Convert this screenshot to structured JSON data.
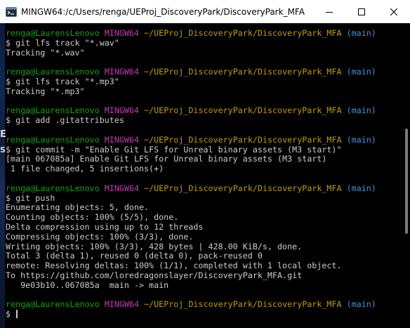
{
  "window": {
    "title": "MINGW64:/c/Users/renga/UEProj_DiscoveryPark/DiscoveryPark_MFA",
    "icon": "mingw-terminal-icon",
    "controls": [
      "minimize-icon",
      "maximize-icon",
      "close-icon"
    ]
  },
  "colors": {
    "user": "#13a10e",
    "system": "#c239b3",
    "path": "#c19c00",
    "branch": "#3a96dd",
    "output": "#cccccc",
    "background": "#000000"
  },
  "prompt": {
    "user": "renga@LaurensLenovo",
    "system": "MINGW64",
    "path": "~/UEProj_DiscoveryPark/DiscoveryPark_MFA",
    "branch": "(main)",
    "symbol": "$"
  },
  "terminal": {
    "blocks": [
      {
        "command": "git lfs track \"*.wav\"",
        "output": [
          "Tracking \"*.wav\""
        ]
      },
      {
        "command": "git lfs track \"*.mp3\"",
        "output": [
          "Tracking \"*.mp3\""
        ]
      },
      {
        "command": "git add .gitattributes",
        "output": []
      },
      {
        "command": "git commit -m \"Enable Git LFS for Unreal binary assets (M3 start)\"",
        "output": [
          "[main 067085a] Enable Git LFS for Unreal binary assets (M3 start)",
          " 1 file changed, 5 insertions(+)"
        ]
      },
      {
        "command": "git push",
        "output": [
          "Enumerating objects: 5, done.",
          "Counting objects: 100% (5/5), done.",
          "Delta compression using up to 12 threads",
          "Compressing objects: 100% (3/3), done.",
          "Writing objects: 100% (3/3), 428 bytes | 428.00 KiB/s, done.",
          "Total 3 (delta 1), reused 0 (delta 0), pack-reused 0",
          "remote: Resolving deltas: 100% (1/1), completed with 1 local object.",
          "To https://github.com/loredragonslayer/DiscoveryPark_MFA.git",
          "   9e03b10..067085a  main -> main"
        ]
      }
    ],
    "final_input": ""
  },
  "left_strip_glyphs": [
    "E",
    "S"
  ]
}
